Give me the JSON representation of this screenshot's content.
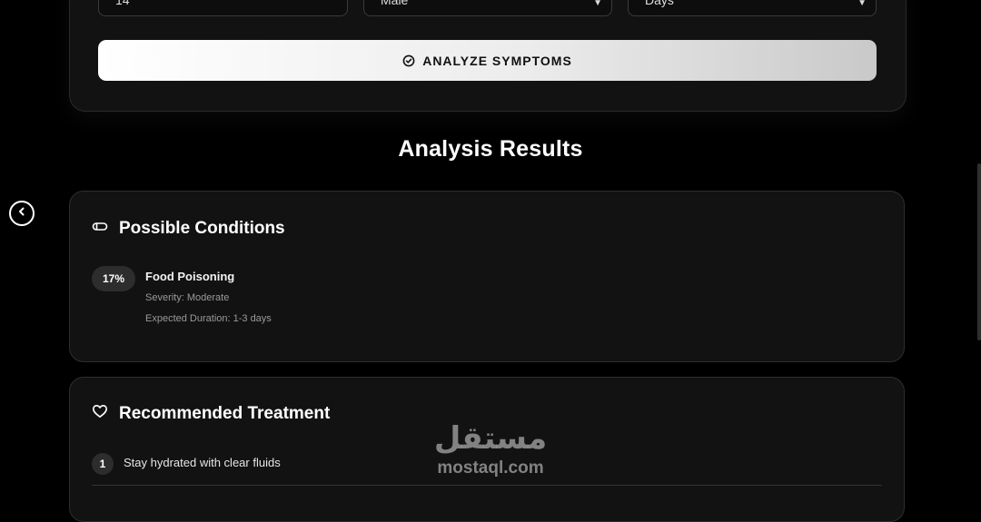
{
  "form": {
    "age_value": "14",
    "gender_value": "Male",
    "duration_unit_value": "Days",
    "analyze_button_label": "ANALYZE SYMPTOMS"
  },
  "results": {
    "title": "Analysis Results",
    "conditions": {
      "heading": "Possible Conditions",
      "items": [
        {
          "probability": "17%",
          "name": "Food Poisoning",
          "severity": "Severity: Moderate",
          "duration": "Expected Duration: 1-3 days"
        }
      ]
    },
    "treatment": {
      "heading": "Recommended Treatment",
      "steps": [
        {
          "number": "1",
          "text": "Stay hydrated with clear fluids"
        }
      ]
    }
  },
  "watermark": {
    "arabic": "مستقل",
    "latin": "mostaql.com"
  },
  "icons": {
    "analyze": "check-circle-icon",
    "conditions": "pill-icon",
    "treatment": "heart-icon",
    "back": "chevron-left-icon"
  }
}
